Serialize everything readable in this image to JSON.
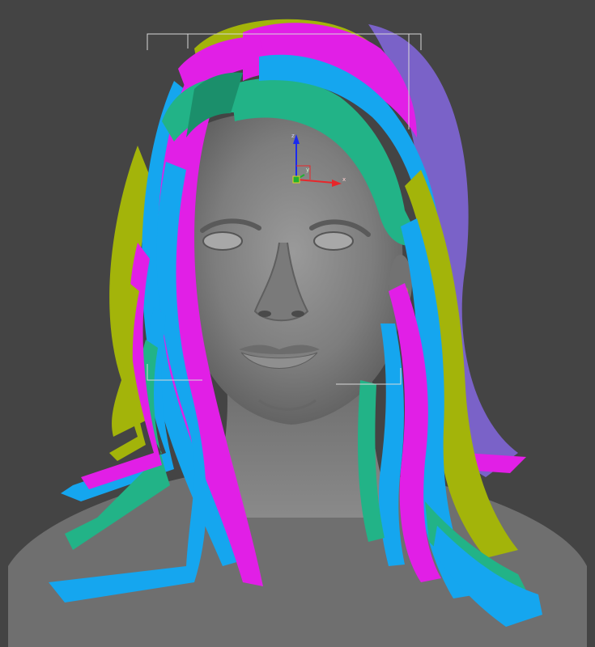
{
  "viewport": {
    "background": "#444444",
    "mode": "perspective"
  },
  "model": {
    "skin_color": "#8a8a8a",
    "hair_strip_colors": [
      "#e11fe6",
      "#15a6ef",
      "#22b387",
      "#a3b40a",
      "#7a62c8"
    ]
  },
  "gizmo": {
    "x_label": "x",
    "y_label": "y",
    "z_label": "z",
    "x_color": "#e8262a",
    "y_color": "#20b030",
    "z_color": "#1a2aef"
  },
  "selection_box": {
    "color": "#d9d9d9"
  }
}
